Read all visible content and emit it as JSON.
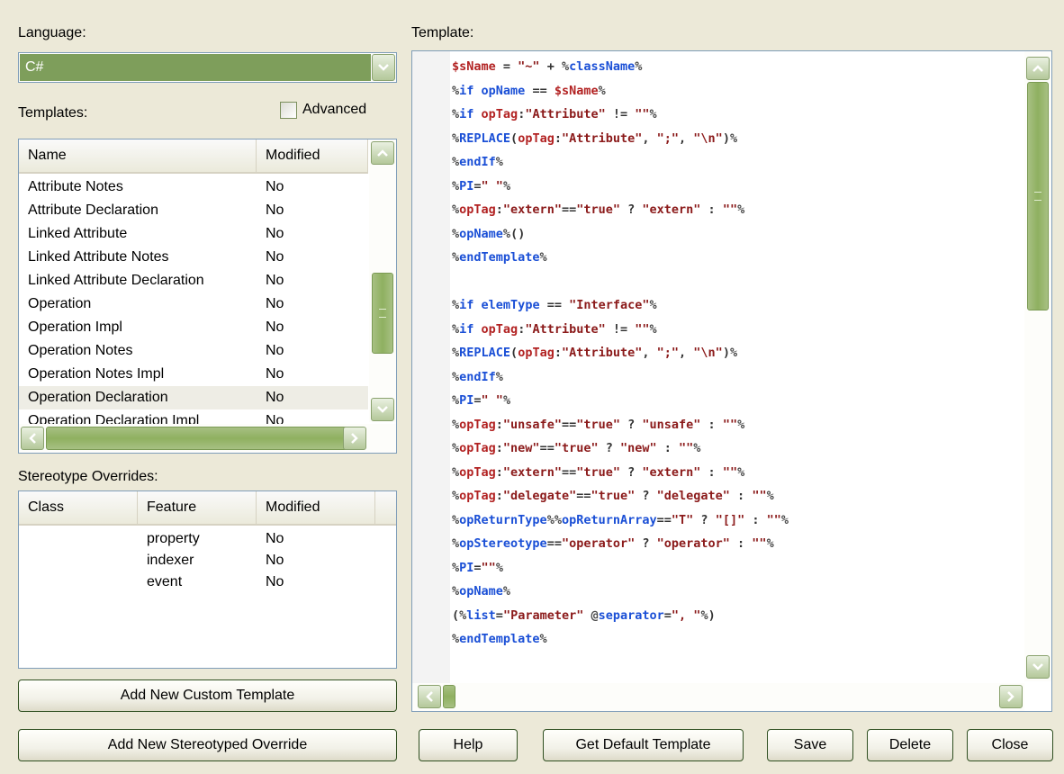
{
  "labels": {
    "language": "Language:",
    "templates": "Templates:",
    "advanced": "Advanced",
    "stereotype_overrides": "Stereotype Overrides:",
    "template": "Template:"
  },
  "language": {
    "selected": "C#"
  },
  "advanced_checked": false,
  "templates_list": {
    "columns": [
      "Name",
      "Modified"
    ],
    "rows": [
      {
        "name": "Attribute Notes",
        "modified": "No"
      },
      {
        "name": "Attribute Declaration",
        "modified": "No"
      },
      {
        "name": "Linked Attribute",
        "modified": "No"
      },
      {
        "name": "Linked Attribute Notes",
        "modified": "No"
      },
      {
        "name": "Linked Attribute Declaration",
        "modified": "No"
      },
      {
        "name": "Operation",
        "modified": "No"
      },
      {
        "name": "Operation Impl",
        "modified": "No"
      },
      {
        "name": "Operation Notes",
        "modified": "No"
      },
      {
        "name": "Operation Notes Impl",
        "modified": "No"
      },
      {
        "name": "Operation Declaration",
        "modified": "No",
        "selected": true
      },
      {
        "name": "Operation Declaration Impl",
        "modified": "No"
      }
    ]
  },
  "overrides_list": {
    "columns": [
      "Class",
      "Feature",
      "Modified"
    ],
    "rows": [
      {
        "class": "",
        "feature": "property",
        "modified": "No"
      },
      {
        "class": "",
        "feature": "indexer",
        "modified": "No"
      },
      {
        "class": "",
        "feature": "event",
        "modified": "No"
      }
    ]
  },
  "buttons": {
    "add_custom_template": "Add New Custom Template",
    "add_stereotyped_override": "Add New Stereotyped Override",
    "help": "Help",
    "get_default_template": "Get Default Template",
    "save": "Save",
    "delete": "Delete",
    "close": "Close"
  },
  "template_code": [
    "$sName = \"~\" + %className%",
    "%if opName == $sName%",
    "%if opTag:\"Attribute\" != \"\"%",
    "%REPLACE(opTag:\"Attribute\", \";\", \"\\n\")%",
    "%endIf%",
    "%PI=\" \"%",
    "%opTag:\"extern\"==\"true\" ? \"extern\" : \"\"%",
    "%opName%()",
    "%endTemplate%",
    "",
    "%if elemType == \"Interface\"%",
    "%if opTag:\"Attribute\" != \"\"%",
    "%REPLACE(opTag:\"Attribute\", \";\", \"\\n\")%",
    "%endIf%",
    "%PI=\" \"%",
    "%opTag:\"unsafe\"==\"true\" ? \"unsafe\" : \"\"%",
    "%opTag:\"new\"==\"true\" ? \"new\" : \"\"%",
    "%opTag:\"extern\"==\"true\" ? \"extern\" : \"\"%",
    "%opTag:\"delegate\"==\"true\" ? \"delegate\" : \"\"%",
    "%opReturnType%%opReturnArray==\"T\" ? \"[]\" : \"\"%",
    "%opStereotype==\"operator\" ? \"operator\" : \"\"%",
    "%PI=\"\"%",
    "%opName%",
    "(%list=\"Parameter\" @separator=\", \"%)",
    "%endTemplate%"
  ],
  "colors": {
    "dialog_bg": "#ece9d8",
    "selection": "#7e9e5b",
    "scroll_thumb": "#8fb060",
    "keyword": "#1a4fd6",
    "string": "#8b1a1a"
  }
}
